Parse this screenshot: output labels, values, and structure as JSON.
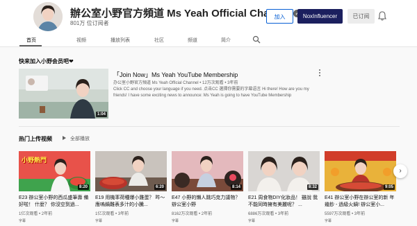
{
  "channel": {
    "name": "辦公室小野官方頻道 Ms Yeah Official Channel",
    "subscribers": "801万 位订阅者",
    "verified_mark": "✓"
  },
  "header_buttons": {
    "join": "加入",
    "nox": "NoxInfluencer",
    "subscribed": "已订阅"
  },
  "tabs": [
    {
      "label": "首页"
    },
    {
      "label": "视频"
    },
    {
      "label": "播放列表"
    },
    {
      "label": "社区"
    },
    {
      "label": "频道"
    },
    {
      "label": "简介"
    }
  ],
  "featured": {
    "section_title": "快来加入小野会员吧❤",
    "title": "「Join Now」Ms Yeah YouTube Membership",
    "meta": "办公室小野官方頻道 Ms Yeah Official Channel • 12万次观看 • 3年前",
    "description": "Click CC and choose your language if you need. 点击CC 選擇你需要的字幕语言 Hi there! How are you my friends! I have some exciting news to announce: Ms Yeah is going to have YouTube Membership",
    "duration": "1:04"
  },
  "uploads": {
    "section_title": "热门上传视频",
    "play_all": "全部播放",
    "next": "›",
    "videos": [
      {
        "duration": "8:20",
        "title": "E23 辦公室小野的西瓜盛筆壽 備好啦！ 什麼？ 你沒空到過...",
        "meta": "1亿次观看 • 2年前",
        "cc": "字幕",
        "thumb_text": "小野熱門"
      },
      {
        "duration": "6:20",
        "title": "E19 用機率荷種爆小雞蛋？ 吽～應嗚鍋難表多汁的小騰...",
        "meta": "1亿次观看 • 3年前",
        "cc": "字幕"
      },
      {
        "duration": "8:14",
        "title": "E47 小野的懶人跳巧克力議物？ 辦公室小野",
        "meta": "8162万次观看 • 2年前",
        "cc": "字幕"
      },
      {
        "duration": "8:32",
        "title": "E21 周食物DIY化妝品！ 雖說 我不能同時擁有美麗呢？ ...",
        "meta": "6886万次观看 • 3年前",
        "cc": "字幕"
      },
      {
        "duration": "9:05",
        "title": "E41 辦公室小野在辦公室的新 年幾鈔 - 過級火鍋! 辦公室小...",
        "meta": "5597万次观看 • 3年前",
        "cc": "字幕"
      }
    ]
  }
}
